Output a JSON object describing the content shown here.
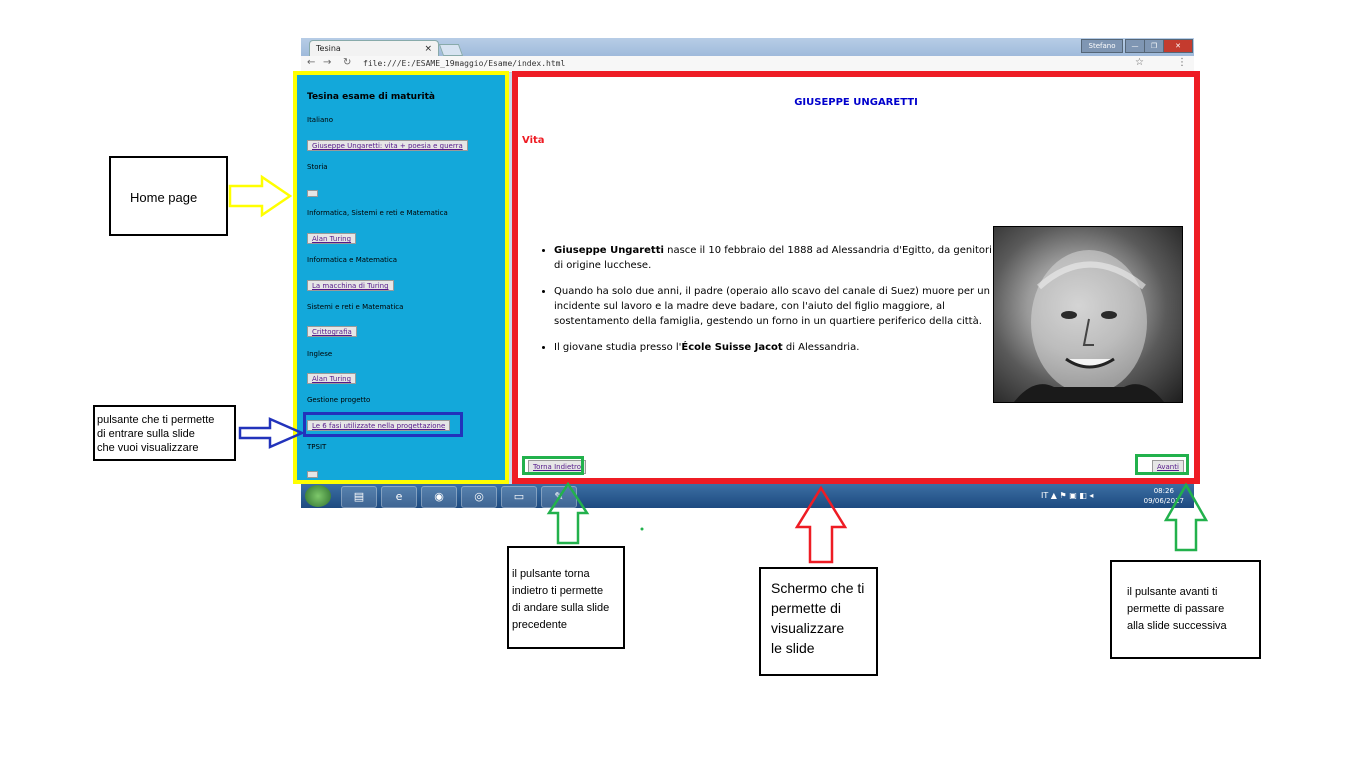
{
  "browser": {
    "tab_title": "Tesina",
    "tab_close": "×",
    "url": "file:///E:/ESAME_19maggio/Esame/index.html",
    "window_user": "Stefano",
    "bookmark_star": "☆",
    "menu_dots": "⋮"
  },
  "sidebar": {
    "title": "Tesina esame di maturità",
    "sections": [
      {
        "label": "Italiano",
        "button": "Giuseppe Ungaretti: vita + poesia e guerra"
      },
      {
        "label": "Storia",
        "button": ""
      },
      {
        "label": "Informatica, Sistemi e reti e Matematica",
        "button": "Alan Turing"
      },
      {
        "label": "Informatica e Matematica",
        "button": "La macchina di Turing"
      },
      {
        "label": "Sistemi e reti e Matematica",
        "button": "Crittografia"
      },
      {
        "label": "Inglese",
        "button": "Alan Turing"
      },
      {
        "label": "Gestione progetto",
        "button": "Le 6 fasi utilizzate nella progettazione"
      },
      {
        "label": "TPSIT",
        "button": ""
      }
    ]
  },
  "slide": {
    "title": "GIUSEPPE UNGARETTI",
    "section": "Vita",
    "bullet1_bold": "Giuseppe Ungaretti",
    "bullet1_text": " nasce il 10 febbraio del 1888 ad Alessandria d'Egitto, da genitori di origine lucchese.",
    "bullet2_text": "Quando ha solo due anni, il padre (operaio allo scavo del canale di Suez) muore per un incidente sul lavoro e la madre deve badare, con l'aiuto del figlio maggiore, al sostentamento della famiglia, gestendo un forno in un quartiere periferico della città.",
    "bullet3_pre": "Il giovane studia presso l'",
    "bullet3_bold": "École Suisse Jacot",
    "bullet3_post": " di Alessandria.",
    "back_button": "Torna Indietro",
    "forward_button": "Avanti"
  },
  "taskbar": {
    "time": "08:26",
    "date": "09/06/2017"
  },
  "annotations": {
    "home": "Home page",
    "slide_button": [
      "pulsante che ti permette",
      "di entrare sulla slide",
      "che vuoi visualizzare"
    ],
    "back": [
      "il pulsante torna",
      "indietro ti permette",
      "di andare sulla slide",
      "precedente"
    ],
    "screen": [
      "Schermo che ti",
      "permette di",
      "visualizzare",
      "le slide"
    ],
    "forward": [
      "il pulsante avanti ti",
      "permette di passare",
      "alla slide successiva"
    ]
  },
  "colors": {
    "sidebar_bg": "#13a8da",
    "sidebar_border": "#ffff00",
    "main_border": "#ee1c24",
    "highlight_blue": "#2233bb",
    "highlight_green": "#22b14c",
    "slide_title": "#0000cc"
  }
}
